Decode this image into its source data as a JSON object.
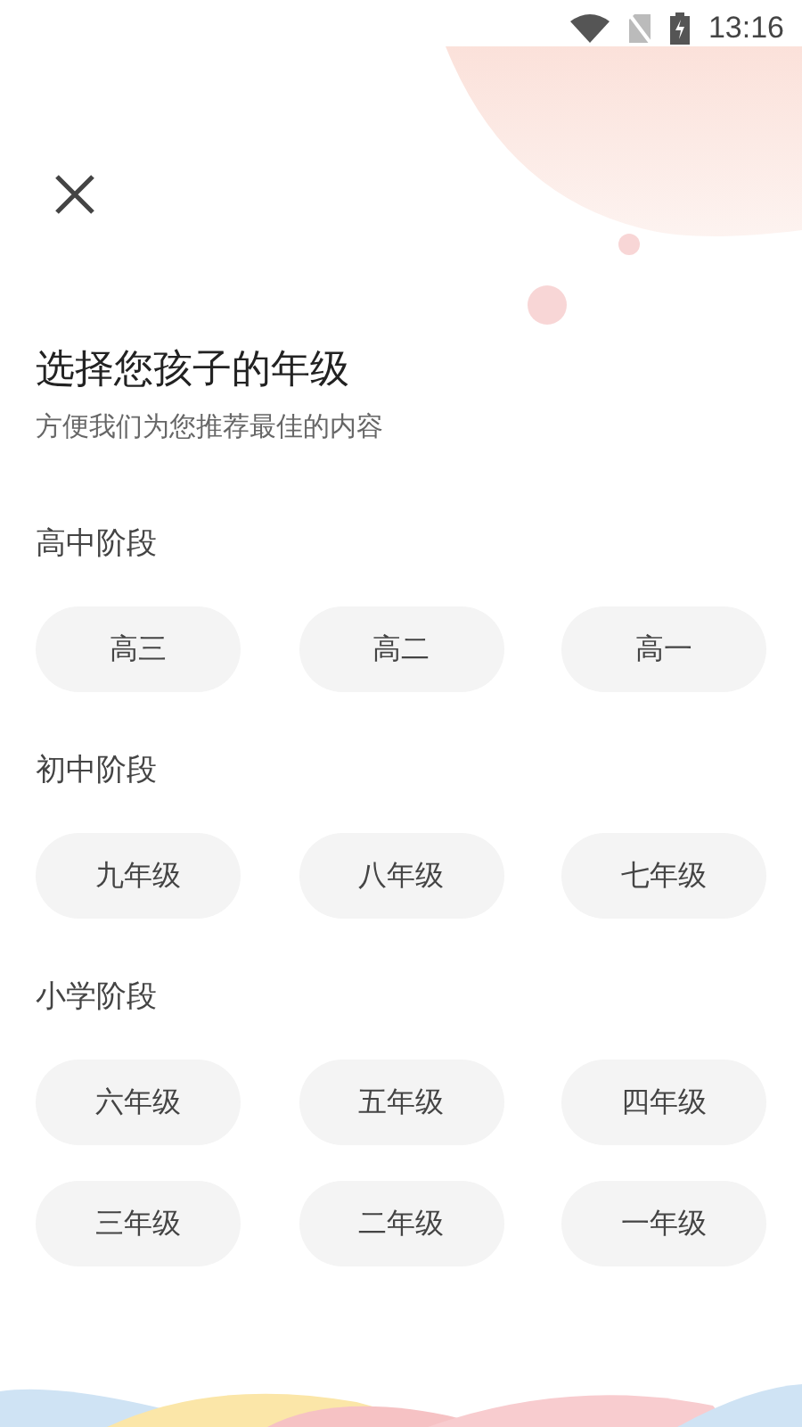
{
  "status_bar": {
    "time": "13:16"
  },
  "title": "选择您孩子的年级",
  "subtitle": "方便我们为您推荐最佳的内容",
  "sections": [
    {
      "label": "高中阶段",
      "grades": [
        {
          "label": "高三",
          "selected": false
        },
        {
          "label": "高二",
          "selected": false
        },
        {
          "label": "高一",
          "selected": false
        }
      ]
    },
    {
      "label": "初中阶段",
      "grades": [
        {
          "label": "九年级",
          "selected": false
        },
        {
          "label": "八年级",
          "selected": false
        },
        {
          "label": "七年级",
          "selected": false
        }
      ]
    },
    {
      "label": "小学阶段",
      "grades": [
        {
          "label": "六年级",
          "selected": false
        },
        {
          "label": "五年级",
          "selected": false
        },
        {
          "label": "四年级",
          "selected": false
        },
        {
          "label": "三年级",
          "selected": false
        },
        {
          "label": "二年级",
          "selected": false
        },
        {
          "label": "一年级",
          "selected": false
        }
      ]
    }
  ]
}
